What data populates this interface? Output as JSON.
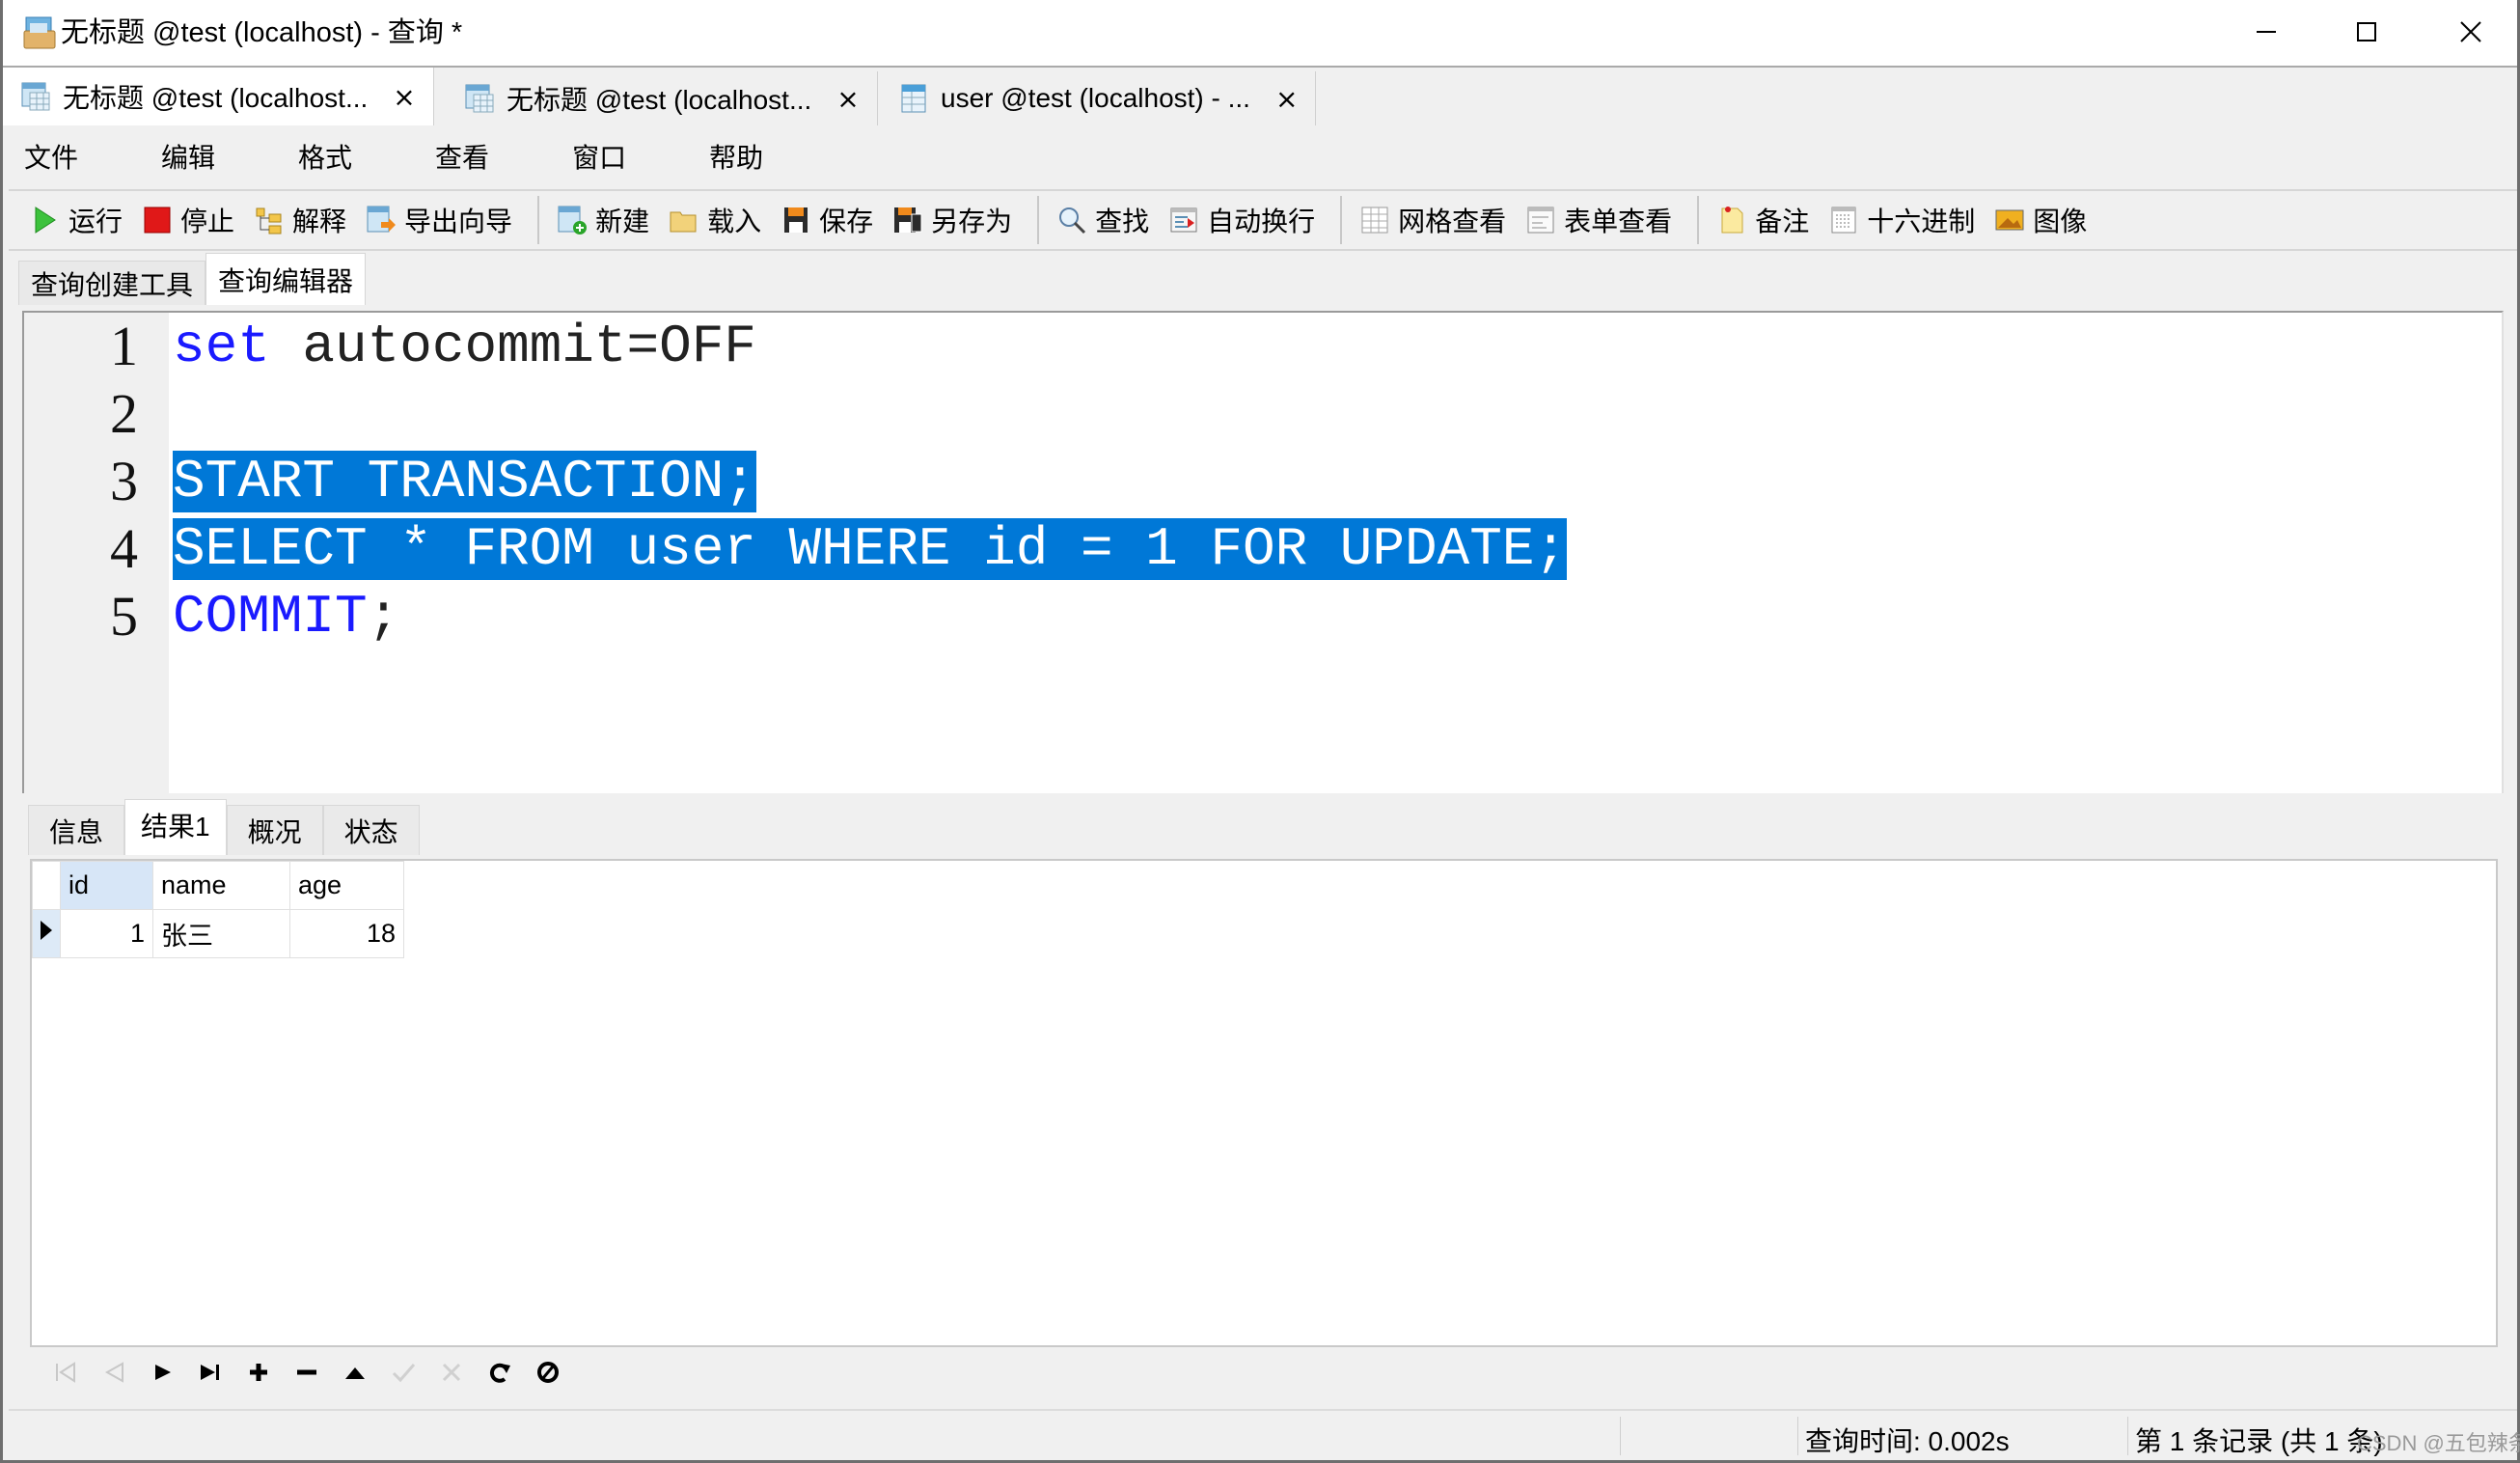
{
  "window": {
    "title": "无标题 @test (localhost) - 查询 *",
    "minimize_icon": "minimize-icon",
    "maximize_icon": "maximize-icon",
    "close_icon": "close-icon"
  },
  "doc_tabs": [
    {
      "label": "无标题 @test (localhost...",
      "icon": "query-table-icon",
      "close": "×",
      "active": true
    },
    {
      "label": "无标题 @test (localhost...",
      "icon": "query-table-icon",
      "close": "×",
      "active": false
    },
    {
      "label": "user @test (localhost) - ...",
      "icon": "table-icon",
      "close": "×",
      "active": false
    }
  ],
  "menu": [
    "文件",
    "编辑",
    "格式",
    "查看",
    "窗口",
    "帮助"
  ],
  "toolbar": [
    {
      "label": "运行",
      "icon": "run-icon"
    },
    {
      "label": "停止",
      "icon": "stop-icon"
    },
    {
      "label": "解释",
      "icon": "explain-icon"
    },
    {
      "label": "导出向导",
      "icon": "export-wizard-icon"
    },
    {
      "label": "新建",
      "icon": "new-icon"
    },
    {
      "label": "载入",
      "icon": "load-icon"
    },
    {
      "label": "保存",
      "icon": "save-icon"
    },
    {
      "label": "另存为",
      "icon": "save-as-icon"
    },
    {
      "label": "查找",
      "icon": "find-icon"
    },
    {
      "label": "自动换行",
      "icon": "word-wrap-icon"
    },
    {
      "label": "网格查看",
      "icon": "grid-view-icon"
    },
    {
      "label": "表单查看",
      "icon": "form-view-icon"
    },
    {
      "label": "备注",
      "icon": "memo-icon"
    },
    {
      "label": "十六进制",
      "icon": "hex-icon"
    },
    {
      "label": "图像",
      "icon": "image-icon"
    }
  ],
  "sub_tabs": [
    {
      "label": "查询创建工具",
      "active": false
    },
    {
      "label": "查询编辑器",
      "active": true
    }
  ],
  "editor": {
    "lines": [
      {
        "no": "1",
        "segments": [
          {
            "text": "set",
            "type": "kw"
          },
          {
            "text": " autocommit=OFF",
            "type": "plain"
          }
        ]
      },
      {
        "no": "2",
        "segments": []
      },
      {
        "no": "3",
        "segments": [
          {
            "text": "START TRANSACTION;",
            "type": "sel"
          }
        ]
      },
      {
        "no": "4",
        "segments": [
          {
            "text": "SELECT * FROM user WHERE id = 1 FOR UPDATE;",
            "type": "sel"
          }
        ]
      },
      {
        "no": "5",
        "segments": [
          {
            "text": "COMMIT",
            "type": "kw"
          },
          {
            "text": ";",
            "type": "plain"
          }
        ]
      }
    ],
    "selection_color": "#0078d7",
    "keyword_color": "#1a1aff"
  },
  "result_tabs": [
    {
      "label": "信息",
      "active": false
    },
    {
      "label": "结果1",
      "active": true
    },
    {
      "label": "概况",
      "active": false
    },
    {
      "label": "状态",
      "active": false
    }
  ],
  "grid": {
    "columns": [
      "id",
      "name",
      "age"
    ],
    "rows": [
      {
        "id": "1",
        "name": "张三",
        "age": "18",
        "current": true
      }
    ]
  },
  "nav_buttons": [
    {
      "name": "first-record",
      "icon": "first-record-icon",
      "enabled": false
    },
    {
      "name": "prev-record",
      "icon": "prev-record-icon",
      "enabled": false
    },
    {
      "name": "next-record",
      "icon": "next-record-icon",
      "enabled": true
    },
    {
      "name": "last-record",
      "icon": "last-record-icon",
      "enabled": true
    },
    {
      "name": "add-record",
      "icon": "plus-icon",
      "enabled": true
    },
    {
      "name": "delete-record",
      "icon": "minus-icon",
      "enabled": true
    },
    {
      "name": "edit-record",
      "icon": "up-triangle-icon",
      "enabled": true
    },
    {
      "name": "apply-changes",
      "icon": "check-icon",
      "enabled": false
    },
    {
      "name": "discard-changes",
      "icon": "x-icon",
      "enabled": false
    },
    {
      "name": "refresh",
      "icon": "refresh-icon",
      "enabled": true
    },
    {
      "name": "stop",
      "icon": "stop-circle-icon",
      "enabled": true
    }
  ],
  "status": {
    "query_time": "查询时间: 0.002s",
    "record_info": "第 1 条记录 (共 1 条)"
  },
  "watermark": "CSDN @五包辣条！"
}
